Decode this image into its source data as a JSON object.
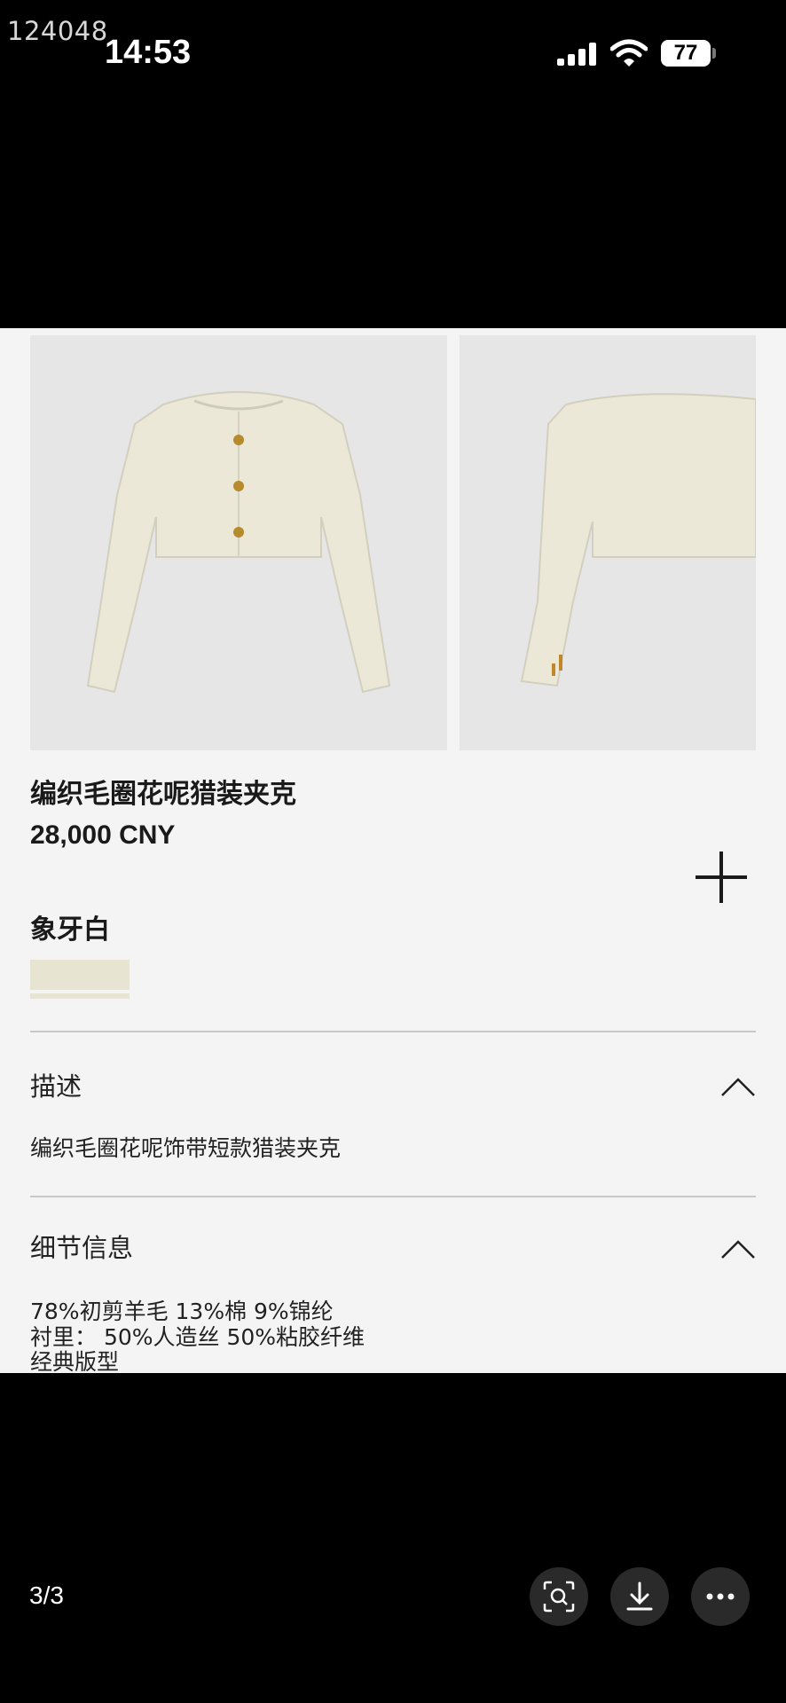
{
  "watermark": "124048",
  "status_bar": {
    "time": "14:53",
    "battery": "77"
  },
  "product": {
    "title": "编织毛圈花呢猎装夹克",
    "price": "28,000 CNY",
    "color_name": "象牙白",
    "swatch_color": "#e8e4d2"
  },
  "sections": [
    {
      "title": "描述",
      "lines": [
        "编织毛圈花呢饰带短款猎装夹克"
      ]
    },
    {
      "title": "细节信息",
      "lines": [
        "78%初剪羊毛 13%棉 9%锦纶",
        "衬里： 50%人造丝 50%粘胶纤维",
        "经典版型"
      ]
    }
  ],
  "viewer": {
    "page_indicator": "3/3"
  },
  "icons": {
    "add": "plus-icon",
    "collapse": "chevron-up-icon",
    "search": "visual-search-icon",
    "download": "download-icon",
    "more": "more-icon"
  }
}
